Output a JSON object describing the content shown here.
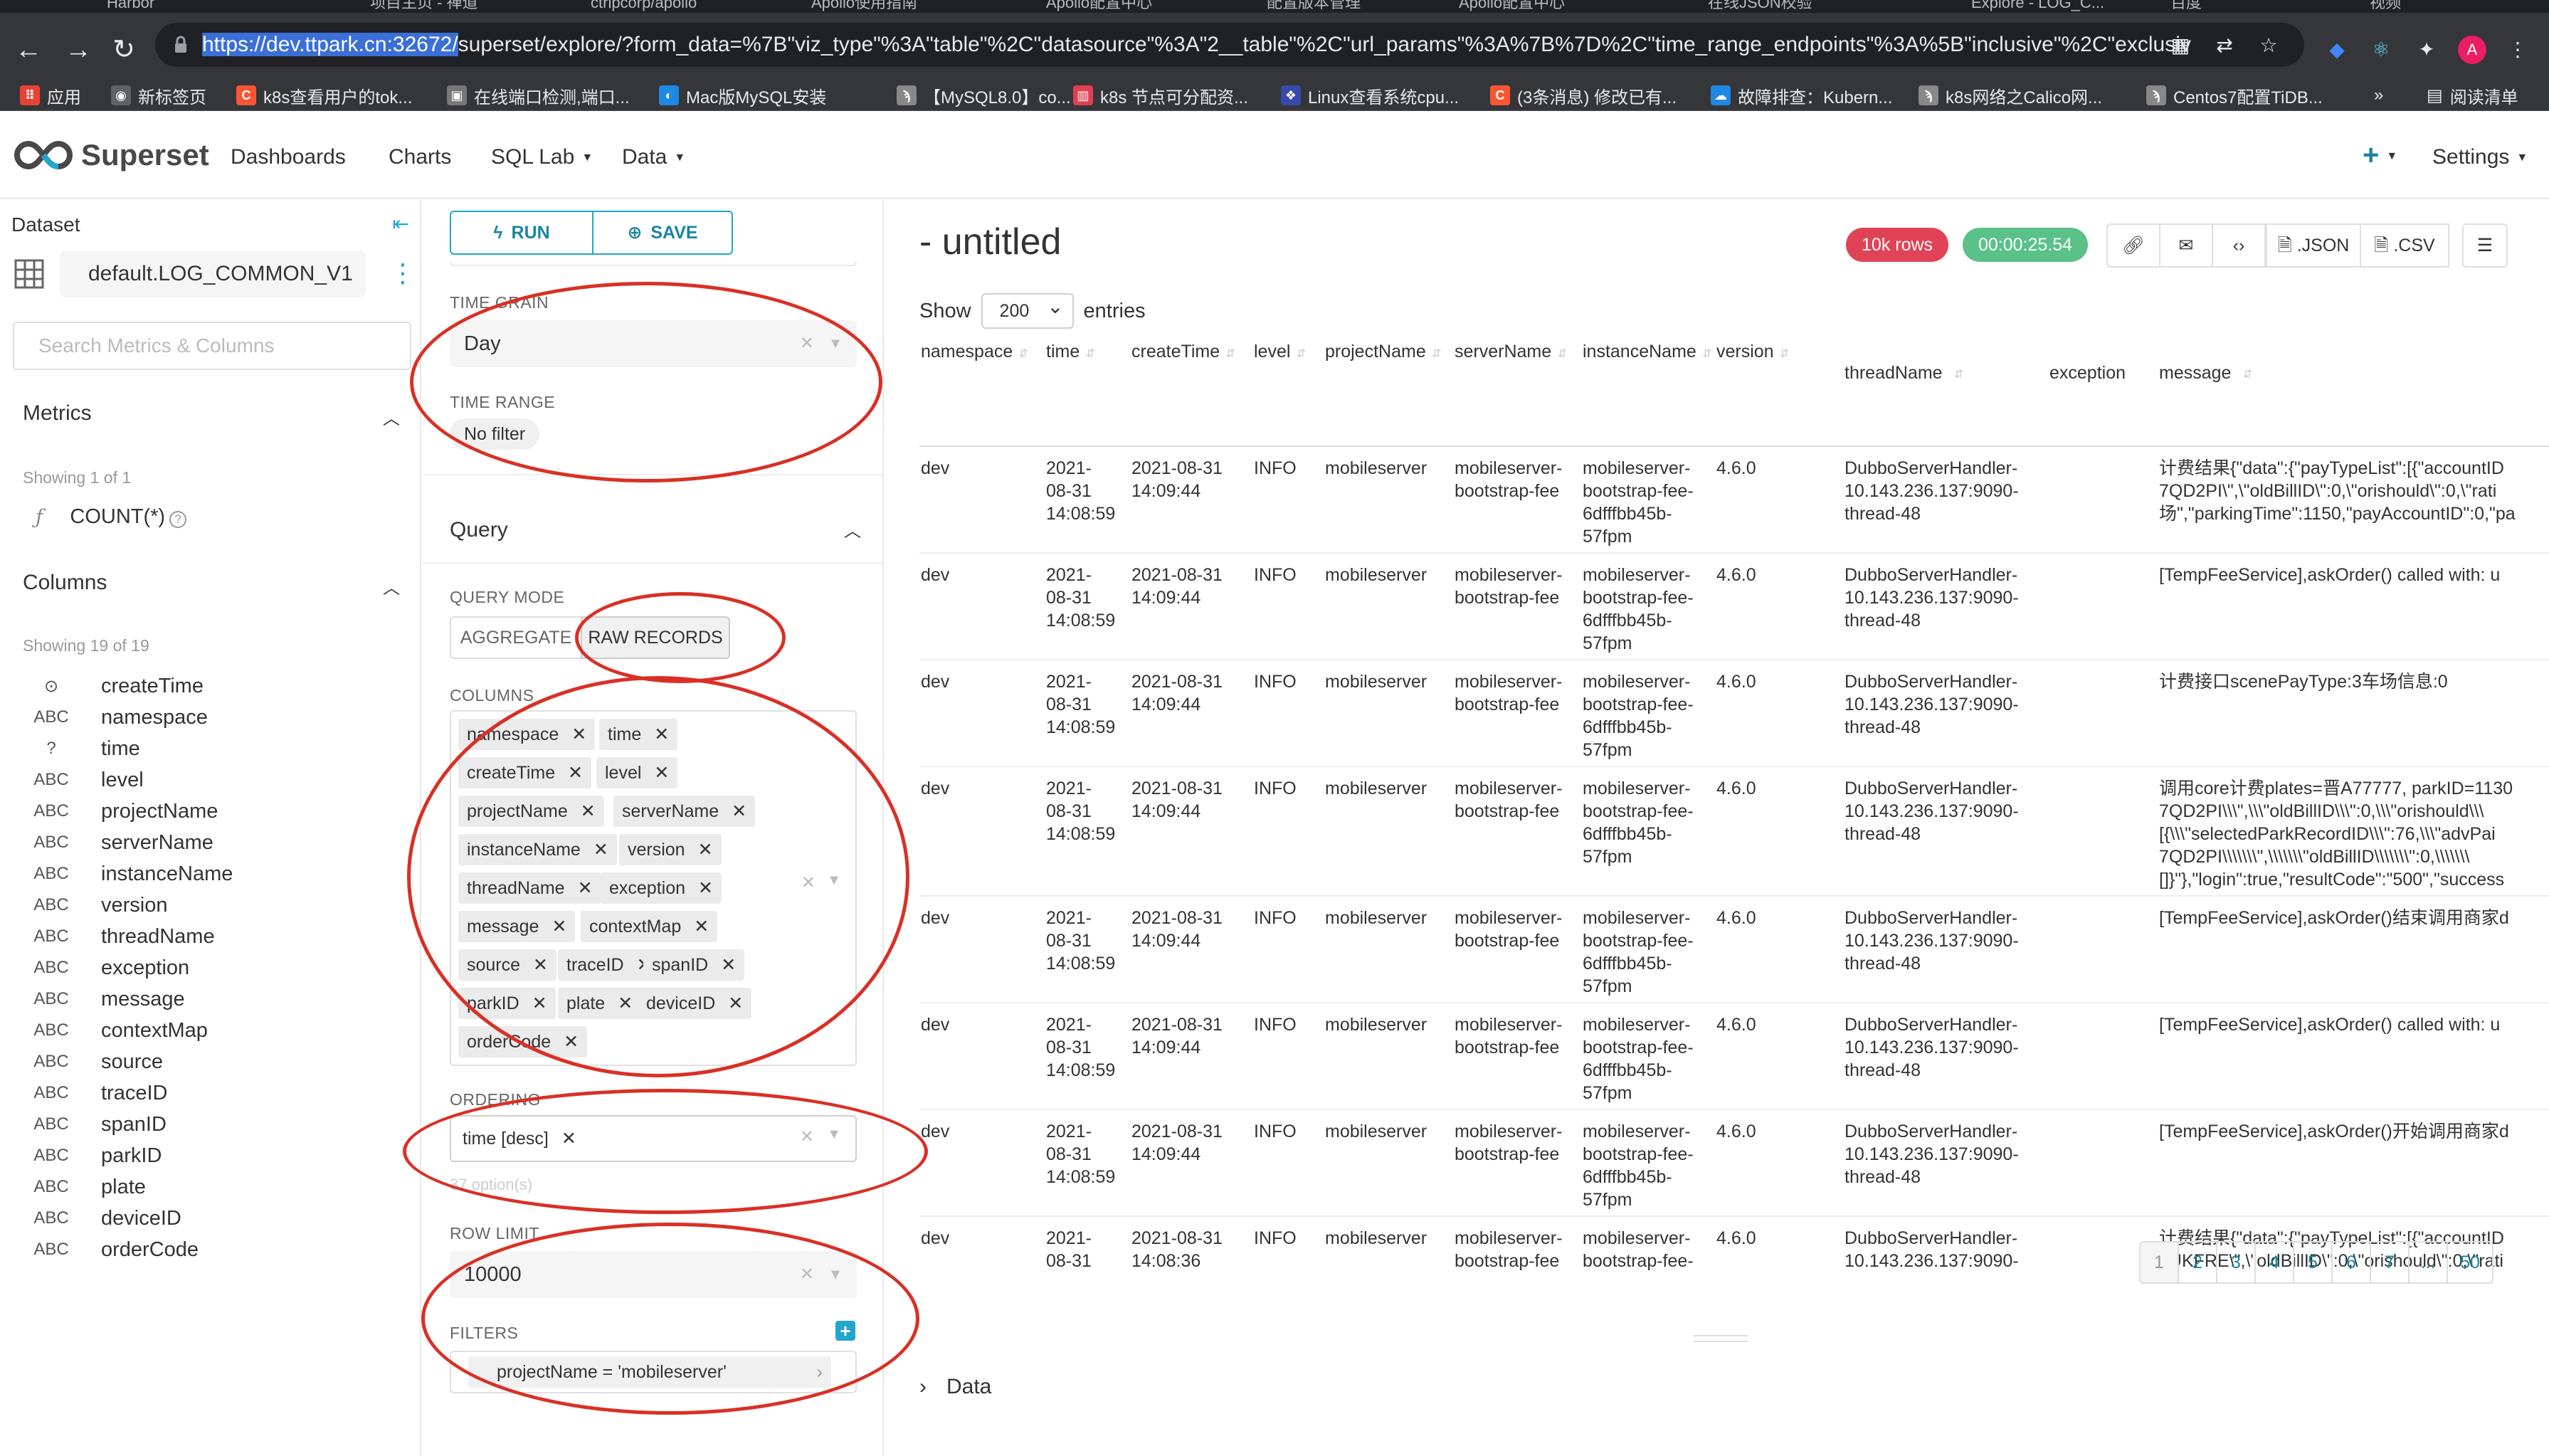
{
  "browser": {
    "tabs": [
      "Harbor",
      "项目主页 - 禅道",
      "ctripcorp/apollo",
      "Apollo使用指南",
      "Apollo配置中心",
      "配置版本管理",
      "Apollo配置中心",
      "在线JSON校验",
      "Explore - LOG_C...",
      "百度",
      "视频"
    ],
    "url_highlight": "https://dev.ttpark.cn:32672/",
    "url_rest": "superset/explore/?form_data=%7B\"viz_type\"%3A\"table\"%2C\"datasource\"%3A\"2__table\"%2C\"url_params\"%3A%7B%7D%2C\"time_range_endpoints\"%3A%5B\"inclusive\"%2C\"exclusiv",
    "bookmarks": [
      {
        "label": "应用",
        "icon": "apps-grid-icon",
        "color": "#e94235"
      },
      {
        "label": "新标签页",
        "icon": "globe-icon",
        "color": "#5f6368"
      },
      {
        "label": "k8s查看用户的tok...",
        "icon": "csdn-icon",
        "color": "#fc5531"
      },
      {
        "label": "在线端口检测,端口...",
        "icon": "tool-icon",
        "color": "#777"
      },
      {
        "label": "Mac版MySQL安装",
        "icon": "swirl-icon",
        "color": "#1e88e5"
      },
      {
        "label": "【MySQL8.0】co...",
        "icon": "feather-icon",
        "color": "#888"
      },
      {
        "label": "k8s 节点可分配资...",
        "icon": "cnblogs-icon",
        "color": "#e04050"
      },
      {
        "label": "Linux查看系统cpu...",
        "icon": "paw-icon",
        "color": "#3949ab"
      },
      {
        "label": "(3条消息) 修改已有...",
        "icon": "csdn-icon",
        "color": "#fc5531"
      },
      {
        "label": "故障排查：Kubern...",
        "icon": "cloud-icon",
        "color": "#1e88e5"
      },
      {
        "label": "k8s网络之Calico网...",
        "icon": "feather-icon",
        "color": "#888"
      },
      {
        "label": "Centos7配置TiDB...",
        "icon": "feather-icon",
        "color": "#888"
      }
    ],
    "more": "»",
    "reading_list": "阅读清单"
  },
  "app": {
    "brand": "Superset",
    "nav": [
      "Dashboards",
      "Charts",
      "SQL Lab",
      "Data"
    ],
    "plus": "+",
    "settings": "Settings"
  },
  "dataset_panel": {
    "title": "Dataset",
    "dataset_name": "default.LOG_COMMON_V1",
    "search_placeholder": "Search Metrics & Columns",
    "metrics_header": "Metrics",
    "metrics_showing": "Showing 1 of 1",
    "metric": "COUNT(*)",
    "columns_header": "Columns",
    "columns_showing": "Showing 19 of 19",
    "columns": [
      {
        "type": "clock",
        "name": "createTime"
      },
      {
        "type": "ABC",
        "name": "namespace"
      },
      {
        "type": "?",
        "name": "time"
      },
      {
        "type": "ABC",
        "name": "level"
      },
      {
        "type": "ABC",
        "name": "projectName"
      },
      {
        "type": "ABC",
        "name": "serverName"
      },
      {
        "type": "ABC",
        "name": "instanceName"
      },
      {
        "type": "ABC",
        "name": "version"
      },
      {
        "type": "ABC",
        "name": "threadName"
      },
      {
        "type": "ABC",
        "name": "exception"
      },
      {
        "type": "ABC",
        "name": "message"
      },
      {
        "type": "ABC",
        "name": "contextMap"
      },
      {
        "type": "ABC",
        "name": "source"
      },
      {
        "type": "ABC",
        "name": "traceID"
      },
      {
        "type": "ABC",
        "name": "spanID"
      },
      {
        "type": "ABC",
        "name": "parkID"
      },
      {
        "type": "ABC",
        "name": "plate"
      },
      {
        "type": "ABC",
        "name": "deviceID"
      },
      {
        "type": "ABC",
        "name": "orderCode"
      }
    ]
  },
  "controls": {
    "run": "RUN",
    "save": "SAVE",
    "time_grain_label": "TIME GRAIN",
    "time_grain_value": "Day",
    "time_range_label": "TIME RANGE",
    "time_range_value": "No filter",
    "query_header": "Query",
    "query_mode_label": "QUERY MODE",
    "query_mode_options": [
      "AGGREGATE",
      "RAW RECORDS"
    ],
    "columns_label": "COLUMNS",
    "selected_columns": [
      "namespace",
      "time",
      "createTime",
      "level",
      "projectName",
      "serverName",
      "instanceName",
      "version",
      "threadName",
      "exception",
      "message",
      "contextMap",
      "source",
      "traceID",
      "spanID",
      "parkID",
      "plate",
      "deviceID",
      "orderCode"
    ],
    "ordering_label": "ORDERING",
    "ordering_value": "time [desc]",
    "ordering_hint": "37 option(s)",
    "row_limit_label": "ROW LIMIT",
    "row_limit_value": "10000",
    "filters_label": "FILTERS",
    "filter_value": "projectName = 'mobileserver'"
  },
  "results": {
    "title": "- untitled",
    "rows_badge": "10k rows",
    "time_badge": "00:00:25.54",
    "actions": [
      ".JSON",
      ".CSV"
    ],
    "show_label": "Show",
    "show_value": "200",
    "entries_label": "entries",
    "headers": [
      "namespace",
      "time",
      "createTime",
      "level",
      "projectName",
      "serverName",
      "instanceName",
      "version",
      "threadName",
      "exception",
      "message"
    ],
    "rows": [
      {
        "namespace": "dev",
        "time": "2021-\n08-31\n14:08:59",
        "createTime": "2021-08-31\n14:09:44",
        "level": "INFO",
        "projectName": "mobileserver",
        "serverName": "mobileserver-\nbootstrap-fee",
        "instanceName": "mobileserver-\nbootstrap-fee-\n6dfffbb45b-\n57fpm",
        "version": "4.6.0",
        "threadName": "DubboServerHandler-\n10.143.236.137:9090-\nthread-48",
        "exception": "",
        "message": "计费结果{\"data\":{\"payTypeList\":[{\"accountID\n7QD2PI\\\",\\\"oldBillID\\\":0,\\\"orishould\\\":0,\\\"rati\n场\",\"parkingTime\":1150,\"payAccountID\":0,\"pa"
      },
      {
        "namespace": "dev",
        "time": "2021-\n08-31\n14:08:59",
        "createTime": "2021-08-31\n14:09:44",
        "level": "INFO",
        "projectName": "mobileserver",
        "serverName": "mobileserver-\nbootstrap-fee",
        "instanceName": "mobileserver-\nbootstrap-fee-\n6dfffbb45b-\n57fpm",
        "version": "4.6.0",
        "threadName": "DubboServerHandler-\n10.143.236.137:9090-\nthread-48",
        "exception": "",
        "message": "[TempFeeService],askOrder() called with: u"
      },
      {
        "namespace": "dev",
        "time": "2021-\n08-31\n14:08:59",
        "createTime": "2021-08-31\n14:09:44",
        "level": "INFO",
        "projectName": "mobileserver",
        "serverName": "mobileserver-\nbootstrap-fee",
        "instanceName": "mobileserver-\nbootstrap-fee-\n6dfffbb45b-\n57fpm",
        "version": "4.6.0",
        "threadName": "DubboServerHandler-\n10.143.236.137:9090-\nthread-48",
        "exception": "",
        "message": "计费接口scenePayType:3车场信息:0"
      },
      {
        "namespace": "dev",
        "time": "2021-\n08-31\n14:08:59",
        "createTime": "2021-08-31\n14:09:44",
        "level": "INFO",
        "projectName": "mobileserver",
        "serverName": "mobileserver-\nbootstrap-fee",
        "instanceName": "mobileserver-\nbootstrap-fee-\n6dfffbb45b-\n57fpm",
        "version": "4.6.0",
        "threadName": "DubboServerHandler-\n10.143.236.137:9090-\nthread-48",
        "exception": "",
        "message": "调用core计费plates=晋A77777, parkID=1130\n7QD2PI\\\\\\\",\\\\\\\"oldBillID\\\\\\\":0,\\\\\\\"orishould\\\\\\\n[{\\\\\\\"selectedParkRecordID\\\\\\\":76,\\\\\\\"advPai\n7QD2PI\\\\\\\\\\\\\\\",\\\\\\\\\\\\\\\"oldBillID\\\\\\\\\\\\\\\":0,\\\\\\\\\\\\\\\n[]}\"},\"login\":true,\"resultCode\":\"500\",\"success"
      },
      {
        "namespace": "dev",
        "time": "2021-\n08-31\n14:08:59",
        "createTime": "2021-08-31\n14:09:44",
        "level": "INFO",
        "projectName": "mobileserver",
        "serverName": "mobileserver-\nbootstrap-fee",
        "instanceName": "mobileserver-\nbootstrap-fee-\n6dfffbb45b-\n57fpm",
        "version": "4.6.0",
        "threadName": "DubboServerHandler-\n10.143.236.137:9090-\nthread-48",
        "exception": "",
        "message": "[TempFeeService],askOrder()结束调用商家d"
      },
      {
        "namespace": "dev",
        "time": "2021-\n08-31\n14:08:59",
        "createTime": "2021-08-31\n14:09:44",
        "level": "INFO",
        "projectName": "mobileserver",
        "serverName": "mobileserver-\nbootstrap-fee",
        "instanceName": "mobileserver-\nbootstrap-fee-\n6dfffbb45b-\n57fpm",
        "version": "4.6.0",
        "threadName": "DubboServerHandler-\n10.143.236.137:9090-\nthread-48",
        "exception": "",
        "message": "[TempFeeService],askOrder() called with: u"
      },
      {
        "namespace": "dev",
        "time": "2021-\n08-31\n14:08:59",
        "createTime": "2021-08-31\n14:09:44",
        "level": "INFO",
        "projectName": "mobileserver",
        "serverName": "mobileserver-\nbootstrap-fee",
        "instanceName": "mobileserver-\nbootstrap-fee-\n6dfffbb45b-\n57fpm",
        "version": "4.6.0",
        "threadName": "DubboServerHandler-\n10.143.236.137:9090-\nthread-48",
        "exception": "",
        "message": "[TempFeeService],askOrder()开始调用商家d"
      },
      {
        "namespace": "dev",
        "time": "2021-\n08-31",
        "createTime": "2021-08-31\n14:08:36",
        "level": "INFO",
        "projectName": "mobileserver",
        "serverName": "mobileserver-\nbootstrap-fee",
        "instanceName": "mobileserver-\nbootstrap-fee-",
        "version": "4.6.0",
        "threadName": "DubboServerHandler-\n10.143.236.137:9090-",
        "exception": "",
        "message": "计费结果{\"data\":{\"payTypeList\":[{\"accountID\n4UKFRE\\\",\\\"oldBillID\\\":0,\\\"orishould\\\":0,\\\"rati"
      }
    ],
    "pages": [
      "1",
      "2",
      "3",
      "4",
      "5",
      "6",
      "7",
      "...",
      "50"
    ],
    "data_toggle": "Data"
  }
}
